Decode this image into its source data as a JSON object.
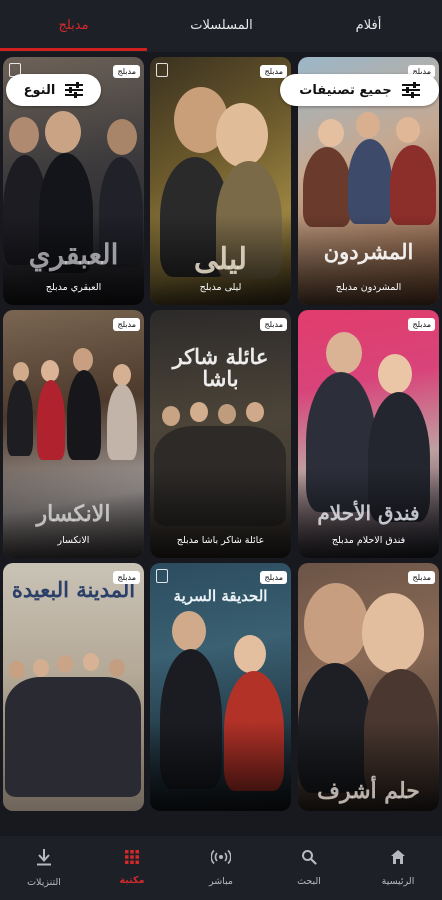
{
  "tabs": [
    {
      "label": "أفلام",
      "active": false
    },
    {
      "label": "المسلسلات",
      "active": false
    },
    {
      "label": "مدبلج",
      "active": true
    }
  ],
  "filters": {
    "genre_label": "النوع",
    "all_categories_label": "جميع تصنيفات"
  },
  "badge_text": "مدبلج",
  "cards": [
    {
      "title": "المشردون مدبلج",
      "poster_text": "المشردون"
    },
    {
      "title": "ليلى مدبلج",
      "poster_text": "ليلى"
    },
    {
      "title": "العبقري مدبلج",
      "poster_text": "العبقري"
    },
    {
      "title": "فندق الاحلام مدبلج",
      "poster_text": "فندق الأحلام"
    },
    {
      "title": "عائلة شاكر باشا مدبلج",
      "poster_text": "عائلة شاكر باشا"
    },
    {
      "title": "الانكسار",
      "poster_text": "الانكسار"
    },
    {
      "title": "",
      "poster_text": "حلم أشرف"
    },
    {
      "title": "",
      "poster_text": "الحديقة السرية"
    },
    {
      "title": "",
      "poster_text": "المدينة البعيدة"
    }
  ],
  "bottom_nav": [
    {
      "label": "الرئيسية",
      "icon": "home-icon",
      "active": false
    },
    {
      "label": "البحث",
      "icon": "search-icon",
      "active": false
    },
    {
      "label": "مباشر",
      "icon": "live-icon",
      "active": false
    },
    {
      "label": "مكتبة",
      "icon": "library-icon",
      "active": true
    },
    {
      "label": "التنزيلات",
      "icon": "download-icon",
      "active": false
    }
  ],
  "colors": {
    "background": "#17191f",
    "bar": "#1e2027",
    "accent": "#d22a2a"
  }
}
